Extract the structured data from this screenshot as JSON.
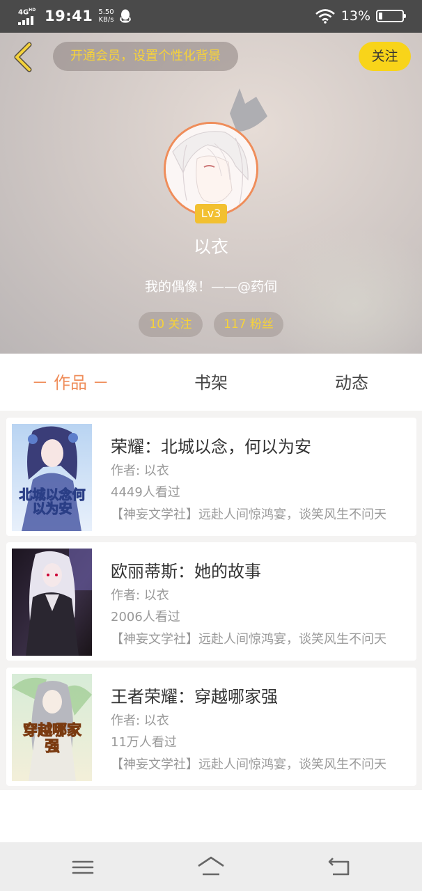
{
  "status_bar": {
    "network": "4G",
    "network_sup": "HD",
    "time": "19:41",
    "speed_value": "5.50",
    "speed_unit": "KB/s",
    "qq_icon": "qq-penguin-icon",
    "wifi_icon": "wifi-icon",
    "battery_percent": "13%",
    "battery_level": 0.13
  },
  "header": {
    "back_icon": "chevron-left-icon",
    "vip_prompt": "开通会员，设置个性化背景",
    "follow_label": "关注",
    "level": "Lv3",
    "username": "以衣",
    "signature": "我的偶像！——@药伺",
    "following": "10 关注",
    "fans": "117 粉丝",
    "colors": {
      "accent": "#ef8d5a",
      "yellow": "#f8d41a",
      "gold_text": "#f6d23a"
    }
  },
  "tabs": [
    {
      "label": "－ 作品 －",
      "active": true
    },
    {
      "label": "书架",
      "active": false
    },
    {
      "label": "动态",
      "active": false
    }
  ],
  "books": [
    {
      "title": "荣耀：北城以念，何以为安",
      "author": "作者: 以衣",
      "views": "4449人看过",
      "desc": "【神妄文学社】远赴人间惊鸿宴，谈笑风生不问天",
      "cover_text": "北城以念何以为安"
    },
    {
      "title": "欧丽蒂斯：她的故事",
      "author": "作者: 以衣",
      "views": "2006人看过",
      "desc": "【神妄文学社】远赴人间惊鸿宴，谈笑风生不问天"
    },
    {
      "title": "王者荣耀：穿越哪家强",
      "author": "作者: 以衣",
      "views": "11万人看过",
      "desc": "【神妄文学社】远赴人间惊鸿宴，谈笑风生不问天",
      "cover_text": "穿越哪家强"
    }
  ],
  "navbar": {
    "menu_icon": "menu-icon",
    "home_icon": "home-icon",
    "back_icon": "back-icon"
  }
}
